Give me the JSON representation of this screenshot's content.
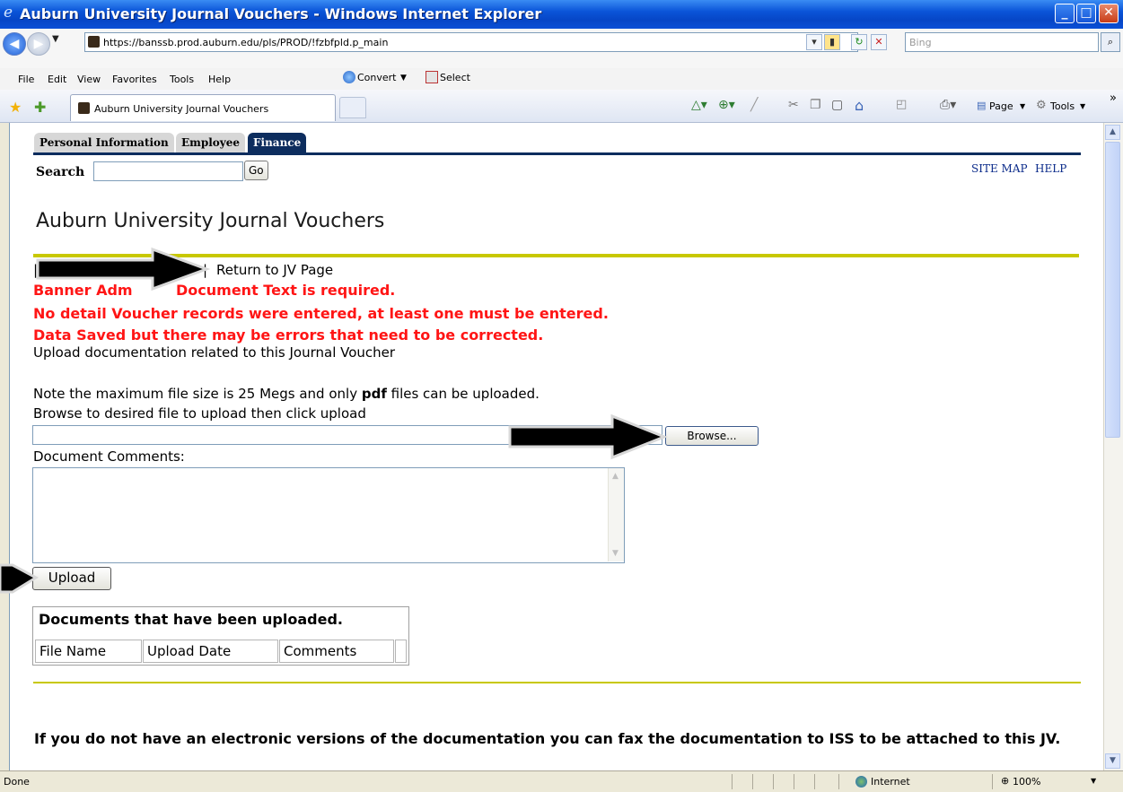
{
  "window": {
    "title": "Auburn University Journal Vouchers - Windows Internet Explorer",
    "controls": {
      "minimize": "_",
      "maximize": "□",
      "close": "✕"
    }
  },
  "address_bar": {
    "url": "https://banssb.prod.auburn.edu/pls/PROD/!fzbfpld.p_main",
    "search_placeholder": "Bing"
  },
  "menu": {
    "items": [
      "File",
      "Edit",
      "View",
      "Favorites",
      "Tools",
      "Help"
    ],
    "convert": "Convert",
    "select": "Select"
  },
  "tab": {
    "label": "Auburn University Journal Vouchers"
  },
  "command_bar": {
    "page": "Page",
    "tools": "Tools"
  },
  "banner_nav": {
    "tabs": [
      "Personal Information",
      "Employee",
      "Finance"
    ],
    "active": "Finance",
    "search_label": "Search",
    "go_label": "Go",
    "site_map": "SITE MAP",
    "help": "HELP"
  },
  "page": {
    "title": "Auburn University Journal Vouchers",
    "nav_prefix": "|",
    "nav_separator": "|",
    "return_link": "Return to JV Page",
    "errors": [
      "Banner Adm",
      "Document Text is required.",
      "No detail Voucher records were entered, at least one must be entered.",
      "Data Saved but there may be errors that need to be corrected."
    ],
    "upload_intro": "Upload documentation related to this Journal Voucher",
    "note_pre": "Note the maximum file size is 25 Megs and only ",
    "note_bold": "pdf",
    "note_post": " files can be uploaded.",
    "browse_instruction": "Browse to desired file to upload then click upload",
    "browse_label": "Browse...",
    "comments_label": "Document Comments:",
    "upload_label": "Upload",
    "table": {
      "heading": "Documents that have been uploaded.",
      "columns": [
        "File Name",
        "Upload Date",
        "Comments"
      ]
    },
    "fax_note": "If you do not have an electronic versions of the documentation you can fax the documentation to ISS to be attached to this JV."
  },
  "status_bar": {
    "status": "Done",
    "zone": "Internet",
    "zoom": "100%"
  },
  "colors": {
    "title_bar": "#0a54d8",
    "nav_dark": "#0d2d5e",
    "error_red": "#ff1515",
    "rule_yellow": "#c8c800",
    "link_blue": "#1f2bbf"
  }
}
